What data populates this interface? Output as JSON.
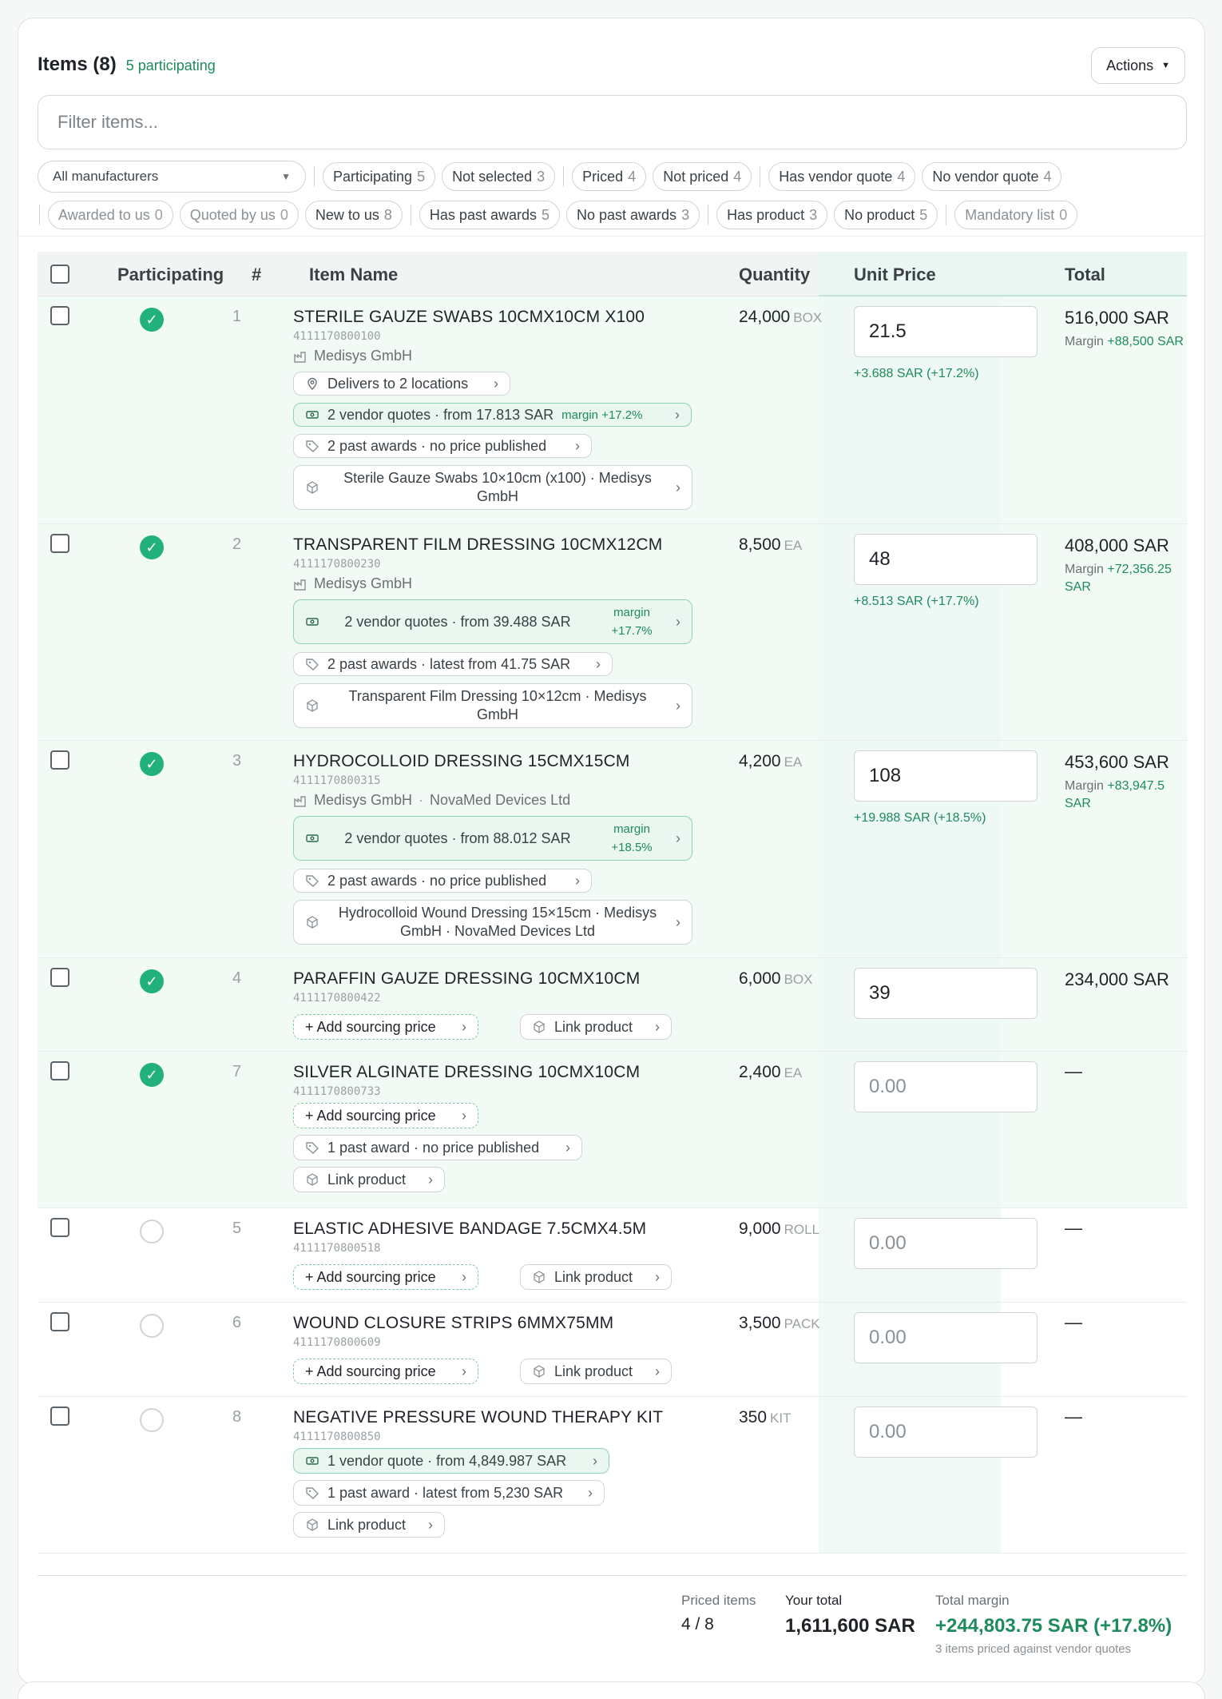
{
  "header": {
    "title": "Items (8)",
    "participating": "5 participating",
    "actions_label": "Actions"
  },
  "filter": {
    "placeholder": "Filter items..."
  },
  "manufacturer_select": {
    "value": "All manufacturers"
  },
  "chips_row1": [
    {
      "label": "Participating",
      "count": "5"
    },
    {
      "label": "Not selected",
      "count": "3"
    },
    {
      "label": "Priced",
      "count": "4"
    },
    {
      "label": "Not priced",
      "count": "4"
    },
    {
      "label": "Has vendor quote",
      "count": "4"
    },
    {
      "label": "No vendor quote",
      "count": "4"
    }
  ],
  "chips_row2": [
    {
      "label": "Awarded to us",
      "count": "0"
    },
    {
      "label": "Quoted by us",
      "count": "0"
    },
    {
      "label": "New to us",
      "count": "8"
    },
    {
      "label": "Has past awards",
      "count": "5"
    },
    {
      "label": "No past awards",
      "count": "3"
    },
    {
      "label": "Has product",
      "count": "3"
    },
    {
      "label": "No product",
      "count": "5"
    },
    {
      "label": "Mandatory list",
      "count": "0"
    }
  ],
  "columns": {
    "participating": "Participating",
    "num": "#",
    "name": "Item Name",
    "quantity": "Quantity",
    "unit_price": "Unit Price",
    "total": "Total"
  },
  "rows": [
    {
      "num": "1",
      "name": "STERILE GAUZE SWABS 10CMX10CM X100",
      "code": "4111170800100",
      "mfr1": "Medisys GmbH",
      "deliver": "Delivers to 2 locations",
      "quotes": "2 vendor quotes · from 17.813 SAR",
      "quotes_margin": "margin +17.2%",
      "awards": "2 past awards · no price published",
      "product": "Sterile Gauze Swabs 10×10cm (x100) · Medisys GmbH",
      "qty": "24,000",
      "unit": "BOX",
      "price": "21.5",
      "delta": "+3.688 SAR (+17.2%)",
      "total": "516,000 SAR",
      "margin_label": "Margin",
      "margin_value": "+88,500 SAR"
    },
    {
      "num": "2",
      "name": "TRANSPARENT FILM DRESSING 10CMX12CM",
      "code": "4111170800230",
      "mfr1": "Medisys GmbH",
      "quotes": "2 vendor quotes · from 39.488 SAR",
      "quotes_margin": "margin +17.7%",
      "awards": "2 past awards · latest from 41.75 SAR",
      "product": "Transparent Film Dressing 10×12cm · Medisys GmbH",
      "qty": "8,500",
      "unit": "EA",
      "price": "48",
      "delta": "+8.513 SAR (+17.7%)",
      "total": "408,000 SAR",
      "margin_label": "Margin",
      "margin_value": "+72,356.25 SAR"
    },
    {
      "num": "3",
      "name": "HYDROCOLLOID DRESSING 15CMX15CM",
      "code": "4111170800315",
      "mfr1": "Medisys GmbH",
      "mfr2": "NovaMed Devices Ltd",
      "quotes": "2 vendor quotes · from 88.012 SAR",
      "quotes_margin": "margin +18.5%",
      "awards": "2 past awards · no price published",
      "product": "Hydrocolloid Wound Dressing 15×15cm · Medisys GmbH · NovaMed Devices Ltd",
      "qty": "4,200",
      "unit": "EA",
      "price": "108",
      "delta": "+19.988 SAR (+18.5%)",
      "total": "453,600 SAR",
      "margin_label": "Margin",
      "margin_value": "+83,947.5 SAR"
    },
    {
      "num": "4",
      "name": "PARAFFIN GAUZE DRESSING 10CMX10CM",
      "code": "4111170800422",
      "add_price": "+ Add sourcing price",
      "link_product": "Link product",
      "qty": "6,000",
      "unit": "BOX",
      "price": "39",
      "total": "234,000 SAR"
    },
    {
      "num": "7",
      "name": "SILVER ALGINATE DRESSING 10CMX10CM",
      "code": "4111170800733",
      "add_price": "+ Add sourcing price",
      "awards": "1 past award · no price published",
      "link_product": "Link product",
      "qty": "2,400",
      "unit": "EA",
      "price_placeholder": "0.00",
      "total": "—"
    },
    {
      "num": "5",
      "name": "ELASTIC ADHESIVE BANDAGE 7.5CMX4.5M",
      "code": "4111170800518",
      "add_price": "+ Add sourcing price",
      "link_product": "Link product",
      "qty": "9,000",
      "unit": "ROLL",
      "price_placeholder": "0.00",
      "total": "—"
    },
    {
      "num": "6",
      "name": "WOUND CLOSURE STRIPS 6MMX75MM",
      "code": "4111170800609",
      "add_price": "+ Add sourcing price",
      "link_product": "Link product",
      "qty": "3,500",
      "unit": "PACK",
      "price_placeholder": "0.00",
      "total": "—"
    },
    {
      "num": "8",
      "name": "NEGATIVE PRESSURE WOUND THERAPY KIT",
      "code": "4111170800850",
      "quotes": "1 vendor quote · from 4,849.987 SAR",
      "awards": "1 past award · latest from 5,230 SAR",
      "link_product": "Link product",
      "qty": "350",
      "unit": "KIT",
      "price_placeholder": "0.00",
      "total": "—"
    }
  ],
  "footer": {
    "priced_label": "Priced items",
    "priced_value": "4 / 8",
    "total_label": "Your total",
    "total_value": "1,611,600 SAR",
    "margin_label": "Total margin",
    "margin_value": "+244,803.75 SAR (+17.8%)",
    "margin_note": "3 items priced against vendor quotes"
  },
  "colors": {
    "accent": "#1e8a5e",
    "check": "#22b07d",
    "row_participating": "#f2faf6"
  },
  "icons": [
    "factory-icon",
    "location-pin-icon",
    "banknote-icon",
    "tag-icon",
    "package-icon",
    "check-icon",
    "chevron-right-icon",
    "caret-down-icon"
  ]
}
